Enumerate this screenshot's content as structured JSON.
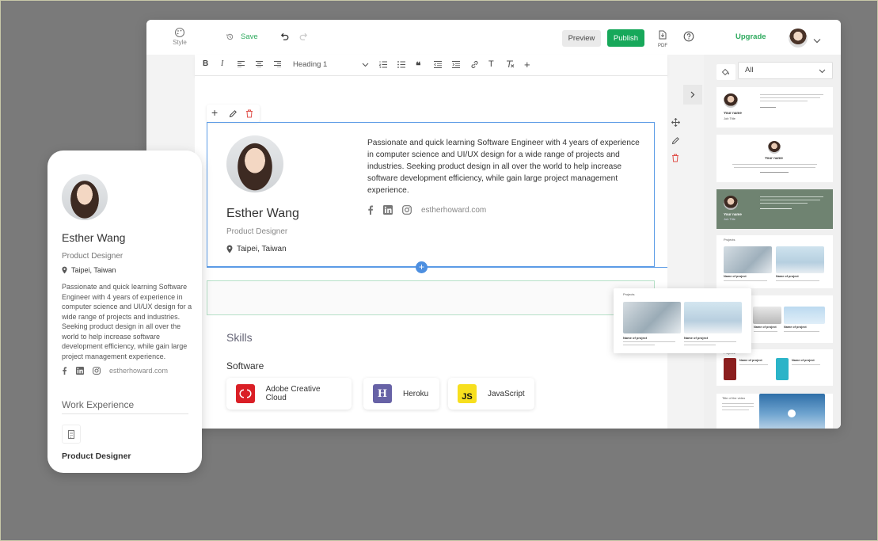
{
  "topbar": {
    "style_label": "Style",
    "save_label": "Save",
    "preview_label": "Preview",
    "publish_label": "Publish",
    "pdf_label": "PDF",
    "upgrade_label": "Upgrade",
    "accent_color": "#17a85a"
  },
  "format_toolbar": {
    "bold": "B",
    "italic": "I",
    "heading_select": "Heading 1",
    "text_tool": "T"
  },
  "profile": {
    "name": "Esther Wang",
    "title": "Product Designer",
    "location": "Taipei, Taiwan",
    "bio": "Passionate and quick learning Software Engineer with 4 years of experience in computer science and UI/UX design for a wide range of projects and industries. Seeking product design in all over the world to help increase software development efficiency, while gain large project management experience.",
    "website": "estherhoward.com"
  },
  "skills": {
    "section_title": "Skills",
    "group_title": "Software",
    "items": [
      {
        "label": "Adobe Creative Cloud",
        "logo": "Cc",
        "color": "#da1f26"
      },
      {
        "label": "Heroku",
        "logo": "H",
        "color": "#6762a6"
      },
      {
        "label": "JavaScript",
        "logo": "JS",
        "color": "#f7df1e"
      }
    ]
  },
  "templates_panel": {
    "filter_value": "All",
    "card_name": "Your name",
    "card_subtitle": "Job Title",
    "projects_label": "Projects",
    "project_name": "Name of project",
    "video_title": "Title of the video"
  },
  "floating_card": {
    "label": "Projects",
    "project_1": "Name of project",
    "project_2": "Name of project"
  },
  "mobile": {
    "work_experience_title": "Work Experience",
    "job_title": "Product Designer"
  }
}
